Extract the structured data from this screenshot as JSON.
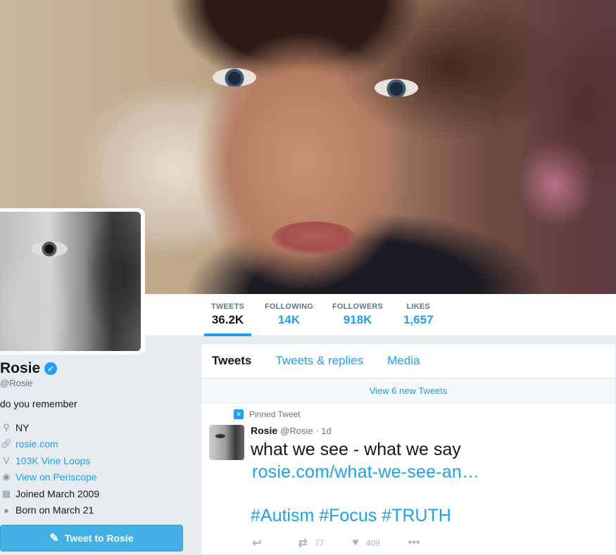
{
  "profile": {
    "name": "Rosie",
    "handle": "@Rosie",
    "bio": "do you remember",
    "location": "NY",
    "website": "rosie.com",
    "vine_loops": "103K Vine Loops",
    "periscope": "View on Periscope",
    "joined": "Joined March 2009",
    "born": "Born on March 21",
    "tweet_to_label": "Tweet to Rosie"
  },
  "stats": [
    {
      "label": "TWEETS",
      "value": "36.2K",
      "active": true
    },
    {
      "label": "FOLLOWING",
      "value": "14K"
    },
    {
      "label": "FOLLOWERS",
      "value": "918K"
    },
    {
      "label": "LIKES",
      "value": "1,657"
    }
  ],
  "timeline": {
    "tabs": [
      "Tweets",
      "Tweets & replies",
      "Media"
    ],
    "new_tweets": "View 6 new Tweets",
    "tweet": {
      "pinned_label": "Pinned Tweet",
      "author_name": "Rosie",
      "author_meta": "@Rosie · 1d",
      "text": "what we see - what we say",
      "link": "rosie.com/what-we-see-an…",
      "hashtags": "#Autism #Focus #TRUTH",
      "retweets": "77",
      "likes": "409"
    }
  },
  "icons": {
    "verified": "verified-badge-icon",
    "location": "location-pin-icon",
    "link": "link-icon",
    "vine": "vine-icon",
    "periscope": "periscope-icon",
    "calendar": "calendar-icon",
    "balloon": "balloon-icon",
    "compose": "compose-icon",
    "pin": "pin-icon",
    "reply": "reply-icon",
    "retweet": "retweet-icon",
    "like": "heart-icon",
    "more": "more-icon"
  },
  "colors": {
    "accent": "#1da1f2",
    "text": "#14171a",
    "muted": "#657786"
  }
}
